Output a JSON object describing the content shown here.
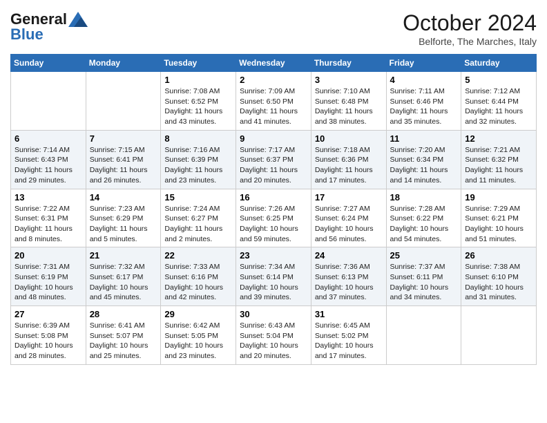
{
  "header": {
    "logo_general": "General",
    "logo_blue": "Blue",
    "month": "October 2024",
    "location": "Belforte, The Marches, Italy"
  },
  "days_of_week": [
    "Sunday",
    "Monday",
    "Tuesday",
    "Wednesday",
    "Thursday",
    "Friday",
    "Saturday"
  ],
  "weeks": [
    [
      {
        "day": "",
        "info": ""
      },
      {
        "day": "",
        "info": ""
      },
      {
        "day": "1",
        "info": "Sunrise: 7:08 AM\nSunset: 6:52 PM\nDaylight: 11 hours and 43 minutes."
      },
      {
        "day": "2",
        "info": "Sunrise: 7:09 AM\nSunset: 6:50 PM\nDaylight: 11 hours and 41 minutes."
      },
      {
        "day": "3",
        "info": "Sunrise: 7:10 AM\nSunset: 6:48 PM\nDaylight: 11 hours and 38 minutes."
      },
      {
        "day": "4",
        "info": "Sunrise: 7:11 AM\nSunset: 6:46 PM\nDaylight: 11 hours and 35 minutes."
      },
      {
        "day": "5",
        "info": "Sunrise: 7:12 AM\nSunset: 6:44 PM\nDaylight: 11 hours and 32 minutes."
      }
    ],
    [
      {
        "day": "6",
        "info": "Sunrise: 7:14 AM\nSunset: 6:43 PM\nDaylight: 11 hours and 29 minutes."
      },
      {
        "day": "7",
        "info": "Sunrise: 7:15 AM\nSunset: 6:41 PM\nDaylight: 11 hours and 26 minutes."
      },
      {
        "day": "8",
        "info": "Sunrise: 7:16 AM\nSunset: 6:39 PM\nDaylight: 11 hours and 23 minutes."
      },
      {
        "day": "9",
        "info": "Sunrise: 7:17 AM\nSunset: 6:37 PM\nDaylight: 11 hours and 20 minutes."
      },
      {
        "day": "10",
        "info": "Sunrise: 7:18 AM\nSunset: 6:36 PM\nDaylight: 11 hours and 17 minutes."
      },
      {
        "day": "11",
        "info": "Sunrise: 7:20 AM\nSunset: 6:34 PM\nDaylight: 11 hours and 14 minutes."
      },
      {
        "day": "12",
        "info": "Sunrise: 7:21 AM\nSunset: 6:32 PM\nDaylight: 11 hours and 11 minutes."
      }
    ],
    [
      {
        "day": "13",
        "info": "Sunrise: 7:22 AM\nSunset: 6:31 PM\nDaylight: 11 hours and 8 minutes."
      },
      {
        "day": "14",
        "info": "Sunrise: 7:23 AM\nSunset: 6:29 PM\nDaylight: 11 hours and 5 minutes."
      },
      {
        "day": "15",
        "info": "Sunrise: 7:24 AM\nSunset: 6:27 PM\nDaylight: 11 hours and 2 minutes."
      },
      {
        "day": "16",
        "info": "Sunrise: 7:26 AM\nSunset: 6:25 PM\nDaylight: 10 hours and 59 minutes."
      },
      {
        "day": "17",
        "info": "Sunrise: 7:27 AM\nSunset: 6:24 PM\nDaylight: 10 hours and 56 minutes."
      },
      {
        "day": "18",
        "info": "Sunrise: 7:28 AM\nSunset: 6:22 PM\nDaylight: 10 hours and 54 minutes."
      },
      {
        "day": "19",
        "info": "Sunrise: 7:29 AM\nSunset: 6:21 PM\nDaylight: 10 hours and 51 minutes."
      }
    ],
    [
      {
        "day": "20",
        "info": "Sunrise: 7:31 AM\nSunset: 6:19 PM\nDaylight: 10 hours and 48 minutes."
      },
      {
        "day": "21",
        "info": "Sunrise: 7:32 AM\nSunset: 6:17 PM\nDaylight: 10 hours and 45 minutes."
      },
      {
        "day": "22",
        "info": "Sunrise: 7:33 AM\nSunset: 6:16 PM\nDaylight: 10 hours and 42 minutes."
      },
      {
        "day": "23",
        "info": "Sunrise: 7:34 AM\nSunset: 6:14 PM\nDaylight: 10 hours and 39 minutes."
      },
      {
        "day": "24",
        "info": "Sunrise: 7:36 AM\nSunset: 6:13 PM\nDaylight: 10 hours and 37 minutes."
      },
      {
        "day": "25",
        "info": "Sunrise: 7:37 AM\nSunset: 6:11 PM\nDaylight: 10 hours and 34 minutes."
      },
      {
        "day": "26",
        "info": "Sunrise: 7:38 AM\nSunset: 6:10 PM\nDaylight: 10 hours and 31 minutes."
      }
    ],
    [
      {
        "day": "27",
        "info": "Sunrise: 6:39 AM\nSunset: 5:08 PM\nDaylight: 10 hours and 28 minutes."
      },
      {
        "day": "28",
        "info": "Sunrise: 6:41 AM\nSunset: 5:07 PM\nDaylight: 10 hours and 25 minutes."
      },
      {
        "day": "29",
        "info": "Sunrise: 6:42 AM\nSunset: 5:05 PM\nDaylight: 10 hours and 23 minutes."
      },
      {
        "day": "30",
        "info": "Sunrise: 6:43 AM\nSunset: 5:04 PM\nDaylight: 10 hours and 20 minutes."
      },
      {
        "day": "31",
        "info": "Sunrise: 6:45 AM\nSunset: 5:02 PM\nDaylight: 10 hours and 17 minutes."
      },
      {
        "day": "",
        "info": ""
      },
      {
        "day": "",
        "info": ""
      }
    ]
  ]
}
